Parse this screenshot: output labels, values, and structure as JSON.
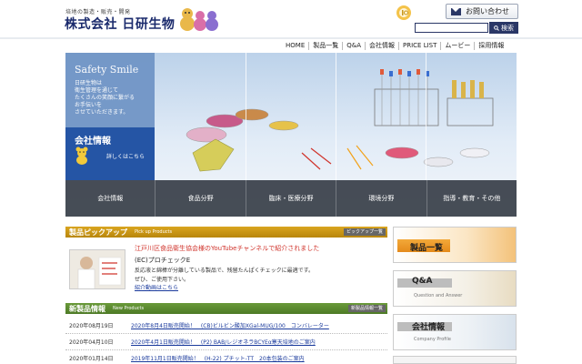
{
  "header": {
    "tagline": "培地の製造・販売・開発",
    "company_name": "株式会社 日研生物",
    "contact_label": "お問い合わせ",
    "search_placeholder": "",
    "search_button": "検索"
  },
  "nav": {
    "items": [
      "HOME",
      "製品一覧",
      "Q&A",
      "会社情報",
      "PRICE LIST",
      "ムービー",
      "採用情報"
    ]
  },
  "hero": {
    "title": "Safety Smile",
    "text": "日研生物は\n衛生管理を通じて\nたくさんの笑顔に繋がる\nお手伝いを\nさせていただきます。",
    "company_box_title": "会社情報",
    "company_box_link": "詳しくはこちら",
    "categories": [
      "会社情報",
      "食品分野",
      "臨床・医療分野",
      "環境分野",
      "指導・教育・その他"
    ]
  },
  "pickup": {
    "title": "製品ピックアップ",
    "subtitle": "Pick up Products",
    "more": "ピックアップ一覧",
    "headline": "江戸川区食品衛生協会様のYouTubeチャンネルで紹介されました",
    "product": "(EC)プロチェックE",
    "desc1": "反応液と綿棒が分離している製品で、残留たんぱくチェックに最適です。",
    "desc2": "ぜひ、ご使用下さい。",
    "link": "紹介動画はこちら"
  },
  "news": {
    "title": "新製品情報",
    "subtitle": "New Products",
    "more": "新製品情報一覧",
    "items": [
      {
        "date": "2020年08月19日",
        "title": "2020年8月4日販売開始！　(CB)ビルビン酸加XGal-MUG/100　コンバレーター"
      },
      {
        "date": "2020年04月10日",
        "title": "2020年4月1日販売開始！　(P2) BAB/レジオネラBCYEα寒天培地のご案内"
      },
      {
        "date": "2020年01月14日",
        "title": "2019年11月1日販売開始！　(H-22) プチット-TT　20本包装のご案内"
      }
    ]
  },
  "sidebar": {
    "banners": [
      {
        "title": "製品一覧",
        "sub": ""
      },
      {
        "title": "Q&A",
        "sub": "Question and Answer"
      },
      {
        "title": "会社情報",
        "sub": "Company Profile"
      },
      {
        "title": "",
        "sub": ""
      }
    ]
  },
  "colors": {
    "brand": "#1a2a6c",
    "pickup_bar": "#c8961a",
    "news_bar": "#5a8a2e",
    "hero_blue": "#2555a5"
  }
}
